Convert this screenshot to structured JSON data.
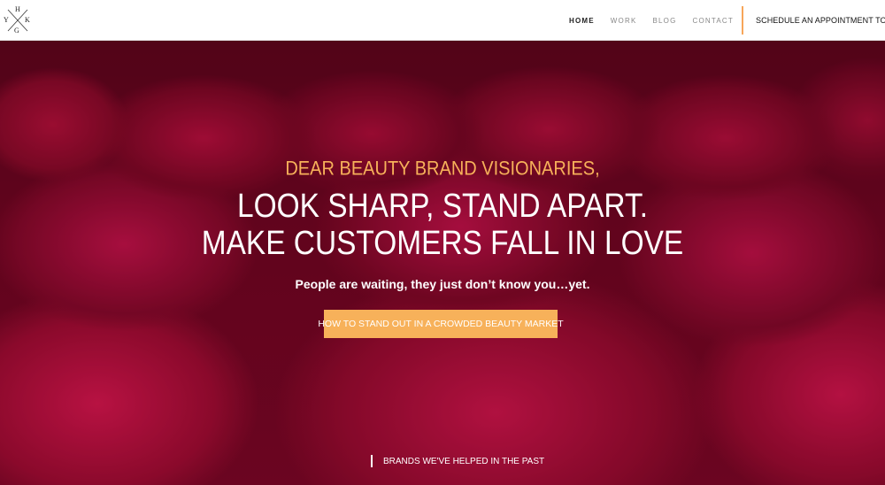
{
  "logo": {
    "letters": {
      "top": "H",
      "left": "Y",
      "right": "K",
      "bottom": "G"
    }
  },
  "nav": {
    "items": [
      {
        "label": "HOME"
      },
      {
        "label": "WORK"
      },
      {
        "label": "BLOG"
      },
      {
        "label": "CONTACT"
      }
    ],
    "cta_label": "SCHEDULE AN APPOINTMENT TODAY"
  },
  "hero": {
    "eyebrow": "DEAR BEAUTY BRAND VISIONARIES,",
    "headline_line1": "LOOK SHARP, STAND APART.",
    "headline_line2": "MAKE CUSTOMERS FALL IN LOVE",
    "subline": "People are waiting, they just don’t know you…yet.",
    "button_label": "HOW TO STAND OUT IN A CROWDED BEAUTY MARKET",
    "brands_link": "BRANDS WE'VE HELPED IN THE PAST"
  },
  "colors": {
    "accent": "#f7b15a",
    "nav_divider": "#f7a65a",
    "hero_base": "#8a0a2a"
  }
}
